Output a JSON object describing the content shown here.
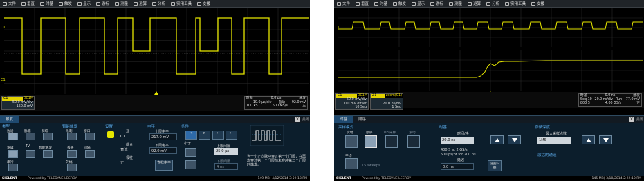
{
  "menu": [
    "文件",
    "垂直",
    "时基",
    "触发",
    "显示",
    "游标",
    "测量",
    "运算",
    "分析",
    "实用工具",
    "支援"
  ],
  "left": {
    "channel": {
      "name": "C1",
      "coupling": "DC1M",
      "vdiv": "50.0 mV/div",
      "offset": "-150.0 mV"
    },
    "timebase": {
      "title": "时基",
      "delay": "0.0 μs",
      "tdiv": "10.0 μs/div",
      "samples": "100 kS",
      "rate": "500 MS/s"
    },
    "trigger": {
      "title": "触发",
      "mode": "自动",
      "level": "92.0 mV",
      "slope": "正"
    },
    "panel": {
      "tab": "触发",
      "close_label": "关闭",
      "type_title": "类型",
      "types": [
        "边沿",
        "脉宽",
        "斜坡",
        "毛刺",
        "窗口",
        "间隔",
        "逻辑",
        "欠幅",
        "TV",
        "智能触发",
        "串行",
        "丢失"
      ],
      "smart_title": "智能触发",
      "setup_title": "设置",
      "source_label": "源",
      "source_value": "C1",
      "coupling_label": "耦合",
      "coupling_value": "直流",
      "polarity_label": "极性",
      "polarity_value": "正",
      "level_title": "电平",
      "upper_label": "上限电平",
      "upper_value": "217.0 mV",
      "lower_label": "下限电平",
      "lower_value": "92.0 mV",
      "find_level": "查找电平",
      "cond_title": "条件",
      "less_than": "小于",
      "upper_interval_label": "上限间隔",
      "upper_interval_value": "25.0 μs",
      "lower_interval_label": "下限间隔",
      "lower_interval_value": "4 ns",
      "description": "当一个正向脉冲穿过第一个门限，在再次穿过第一个门限前未穿越第二个门限时触发。"
    },
    "status": {
      "mem": "(149 MB)",
      "datetime": "4/12/2014 3:59:18 PM"
    }
  },
  "right": {
    "c1": {
      "name": "C1",
      "coupling": "DC1M",
      "vdiv": "50.0 mV/div",
      "offset": "0.0 mV offset",
      "seg": "10 Seg"
    },
    "z1": {
      "name": "Z1",
      "source": "zoom(C1)",
      "tdiv": "20.0 ns/div",
      "seg": "1 Seg"
    },
    "timebase": {
      "title": "时基",
      "delay": "0.0 ns",
      "tdiv": "20.0 ns/div",
      "seq": "Seq 10",
      "samples": "800 S",
      "rate": "4.00 GS/s"
    },
    "trigger": {
      "title": "触发",
      "mode": "Run",
      "level": "-77.0 mV",
      "slope": "正"
    },
    "panel": {
      "tabs": [
        "时基",
        "顺序"
      ],
      "close_label": "关闭",
      "mode_title": "采样模式",
      "modes": [
        "实时",
        "顺序",
        "RIS采样",
        "滚动"
      ],
      "avg_label": "平均",
      "sweeps": "15 sweeps",
      "timebase_title": "时基",
      "tdiv_label": "时间/格",
      "tdiv_value": "20.0 ns",
      "rate_line1": "400 S at 2 GS/s",
      "rate_line2": "500 ps/pt for 200 ns",
      "delay_label": "延迟",
      "delay_value": "0.0 ns",
      "set_zero": "设置归零",
      "memory_title": "存储深度",
      "max_samples_label": "最大采样点数",
      "max_samples_value": "1MS",
      "activate_channels": "激活的通道"
    },
    "status": {
      "mem": "(145 MB)",
      "datetime": "3/10/2014 2:22:10 PM"
    }
  },
  "brand": "SIGLENT",
  "powered": "Powered by TELEDYNE LECROY",
  "colors": {
    "trace": "#e6e600",
    "panel": "#0c1e2c",
    "accent": "#5aa8e6"
  }
}
